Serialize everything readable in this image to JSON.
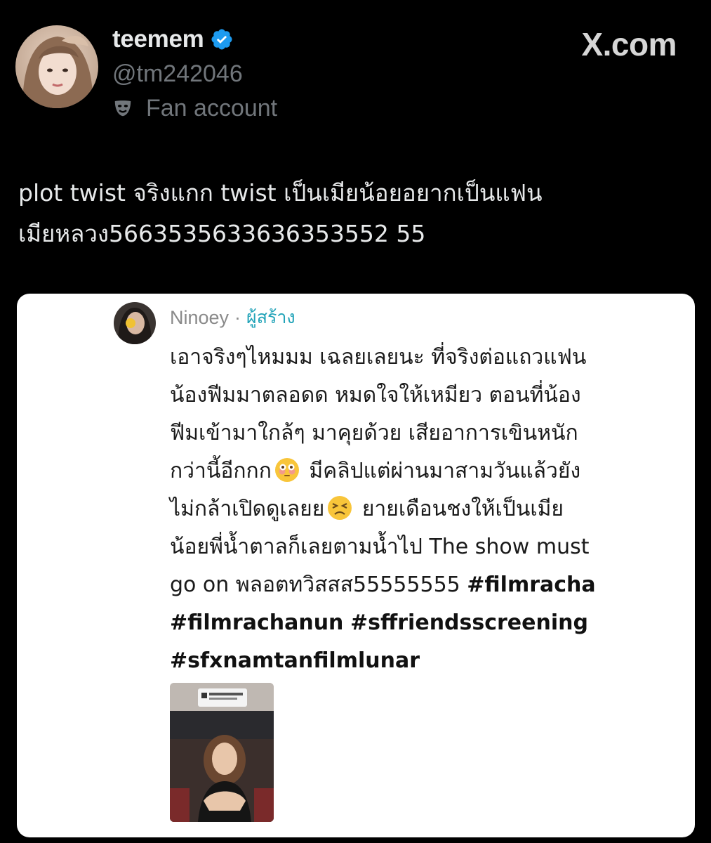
{
  "colors": {
    "background": "#000000",
    "verified_badge": "#1d9bf0",
    "muted_text": "#71767b",
    "creator_label": "#21a3b8",
    "card_background": "#ffffff"
  },
  "author": {
    "display_name": "teemem",
    "handle": "@tm242046",
    "label_icon": "mask-icon",
    "label": "Fan account",
    "verified_icon": "verified-badge-icon"
  },
  "brand": {
    "text": "X.com"
  },
  "tweet": {
    "lines": [
      "plot twist จริงแกก twist เป็นเมียน้อยอยากเป็นแฟน",
      "เมียหลวง5663535633636353552 55"
    ]
  },
  "quote": {
    "author_name": "Ninoey",
    "separator": "·",
    "role_label": "ผู้สร้าง",
    "lines": [
      {
        "text": "เอาจริงๆไหมมม เฉลยเลยนะ ที่จริงต่อแถวแฟน"
      },
      {
        "text": "น้องฟีมมาตลอดด หมดใจให้เหมียว ตอนที่น้อง"
      },
      {
        "text": "ฟีมเข้ามาใกล้ๆ มาคุยด้วย เสียอาการเขินหนัก"
      },
      {
        "text": "กว่านี้อีกกก",
        "emoji": "flushed-face-emoji",
        "after": " มีคลิปแต่ผ่านมาสามวันแล้วยัง"
      },
      {
        "text": "ไม่กล้าเปิดดูเลยย",
        "emoji": "persevering-face-emoji",
        "after": "  ยายเดือนชงให้เป็นเมีย"
      },
      {
        "text": "น้อยพี่น้ำตาลก็เลยตามน้ำไป The show must"
      },
      {
        "text": "go on พลอตทวิสสส55555555  ",
        "tag": "#filmracha"
      },
      {
        "tag": "#filmrachanun",
        "tag2": "#sffriendsscreening"
      },
      {
        "tag": "#sfxnamtanfilmlunar"
      }
    ],
    "media_description": "video-thumbnail"
  }
}
